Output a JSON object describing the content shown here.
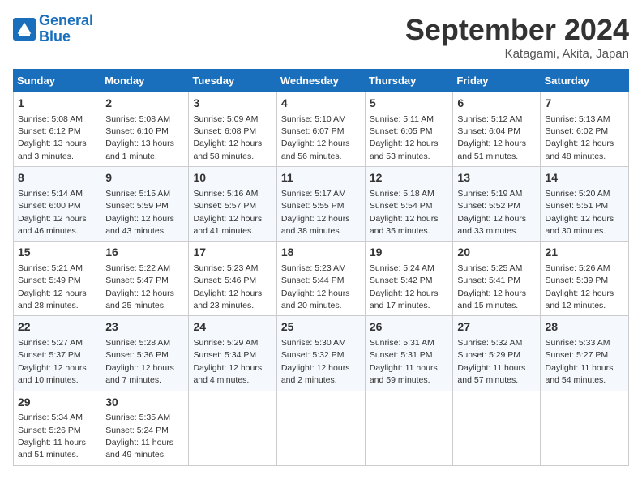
{
  "header": {
    "logo_line1": "General",
    "logo_line2": "Blue",
    "month": "September 2024",
    "location": "Katagami, Akita, Japan"
  },
  "weekdays": [
    "Sunday",
    "Monday",
    "Tuesday",
    "Wednesday",
    "Thursday",
    "Friday",
    "Saturday"
  ],
  "weeks": [
    [
      {
        "day": "1",
        "info": "Sunrise: 5:08 AM\nSunset: 6:12 PM\nDaylight: 13 hours\nand 3 minutes."
      },
      {
        "day": "2",
        "info": "Sunrise: 5:08 AM\nSunset: 6:10 PM\nDaylight: 13 hours\nand 1 minute."
      },
      {
        "day": "3",
        "info": "Sunrise: 5:09 AM\nSunset: 6:08 PM\nDaylight: 12 hours\nand 58 minutes."
      },
      {
        "day": "4",
        "info": "Sunrise: 5:10 AM\nSunset: 6:07 PM\nDaylight: 12 hours\nand 56 minutes."
      },
      {
        "day": "5",
        "info": "Sunrise: 5:11 AM\nSunset: 6:05 PM\nDaylight: 12 hours\nand 53 minutes."
      },
      {
        "day": "6",
        "info": "Sunrise: 5:12 AM\nSunset: 6:04 PM\nDaylight: 12 hours\nand 51 minutes."
      },
      {
        "day": "7",
        "info": "Sunrise: 5:13 AM\nSunset: 6:02 PM\nDaylight: 12 hours\nand 48 minutes."
      }
    ],
    [
      {
        "day": "8",
        "info": "Sunrise: 5:14 AM\nSunset: 6:00 PM\nDaylight: 12 hours\nand 46 minutes."
      },
      {
        "day": "9",
        "info": "Sunrise: 5:15 AM\nSunset: 5:59 PM\nDaylight: 12 hours\nand 43 minutes."
      },
      {
        "day": "10",
        "info": "Sunrise: 5:16 AM\nSunset: 5:57 PM\nDaylight: 12 hours\nand 41 minutes."
      },
      {
        "day": "11",
        "info": "Sunrise: 5:17 AM\nSunset: 5:55 PM\nDaylight: 12 hours\nand 38 minutes."
      },
      {
        "day": "12",
        "info": "Sunrise: 5:18 AM\nSunset: 5:54 PM\nDaylight: 12 hours\nand 35 minutes."
      },
      {
        "day": "13",
        "info": "Sunrise: 5:19 AM\nSunset: 5:52 PM\nDaylight: 12 hours\nand 33 minutes."
      },
      {
        "day": "14",
        "info": "Sunrise: 5:20 AM\nSunset: 5:51 PM\nDaylight: 12 hours\nand 30 minutes."
      }
    ],
    [
      {
        "day": "15",
        "info": "Sunrise: 5:21 AM\nSunset: 5:49 PM\nDaylight: 12 hours\nand 28 minutes."
      },
      {
        "day": "16",
        "info": "Sunrise: 5:22 AM\nSunset: 5:47 PM\nDaylight: 12 hours\nand 25 minutes."
      },
      {
        "day": "17",
        "info": "Sunrise: 5:23 AM\nSunset: 5:46 PM\nDaylight: 12 hours\nand 23 minutes."
      },
      {
        "day": "18",
        "info": "Sunrise: 5:23 AM\nSunset: 5:44 PM\nDaylight: 12 hours\nand 20 minutes."
      },
      {
        "day": "19",
        "info": "Sunrise: 5:24 AM\nSunset: 5:42 PM\nDaylight: 12 hours\nand 17 minutes."
      },
      {
        "day": "20",
        "info": "Sunrise: 5:25 AM\nSunset: 5:41 PM\nDaylight: 12 hours\nand 15 minutes."
      },
      {
        "day": "21",
        "info": "Sunrise: 5:26 AM\nSunset: 5:39 PM\nDaylight: 12 hours\nand 12 minutes."
      }
    ],
    [
      {
        "day": "22",
        "info": "Sunrise: 5:27 AM\nSunset: 5:37 PM\nDaylight: 12 hours\nand 10 minutes."
      },
      {
        "day": "23",
        "info": "Sunrise: 5:28 AM\nSunset: 5:36 PM\nDaylight: 12 hours\nand 7 minutes."
      },
      {
        "day": "24",
        "info": "Sunrise: 5:29 AM\nSunset: 5:34 PM\nDaylight: 12 hours\nand 4 minutes."
      },
      {
        "day": "25",
        "info": "Sunrise: 5:30 AM\nSunset: 5:32 PM\nDaylight: 12 hours\nand 2 minutes."
      },
      {
        "day": "26",
        "info": "Sunrise: 5:31 AM\nSunset: 5:31 PM\nDaylight: 11 hours\nand 59 minutes."
      },
      {
        "day": "27",
        "info": "Sunrise: 5:32 AM\nSunset: 5:29 PM\nDaylight: 11 hours\nand 57 minutes."
      },
      {
        "day": "28",
        "info": "Sunrise: 5:33 AM\nSunset: 5:27 PM\nDaylight: 11 hours\nand 54 minutes."
      }
    ],
    [
      {
        "day": "29",
        "info": "Sunrise: 5:34 AM\nSunset: 5:26 PM\nDaylight: 11 hours\nand 51 minutes."
      },
      {
        "day": "30",
        "info": "Sunrise: 5:35 AM\nSunset: 5:24 PM\nDaylight: 11 hours\nand 49 minutes."
      },
      {
        "day": "",
        "info": ""
      },
      {
        "day": "",
        "info": ""
      },
      {
        "day": "",
        "info": ""
      },
      {
        "day": "",
        "info": ""
      },
      {
        "day": "",
        "info": ""
      }
    ]
  ]
}
